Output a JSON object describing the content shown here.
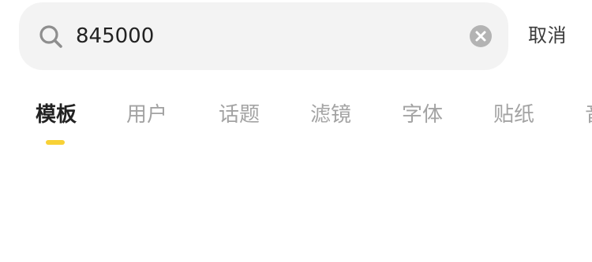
{
  "search": {
    "value": "845000",
    "placeholder": "",
    "cancel_label": "取消",
    "icon": "search-icon",
    "clear_icon": "clear-icon"
  },
  "tabs": [
    {
      "label": "模板",
      "active": true
    },
    {
      "label": "用户",
      "active": false
    },
    {
      "label": "话题",
      "active": false
    },
    {
      "label": "滤镜",
      "active": false
    },
    {
      "label": "字体",
      "active": false
    },
    {
      "label": "贴纸",
      "active": false
    },
    {
      "label": "音",
      "active": false
    }
  ],
  "colors": {
    "accent": "#f8d136",
    "active_text": "#222222",
    "inactive_text": "#a3a3a3",
    "search_bg": "#f3f3f3"
  }
}
